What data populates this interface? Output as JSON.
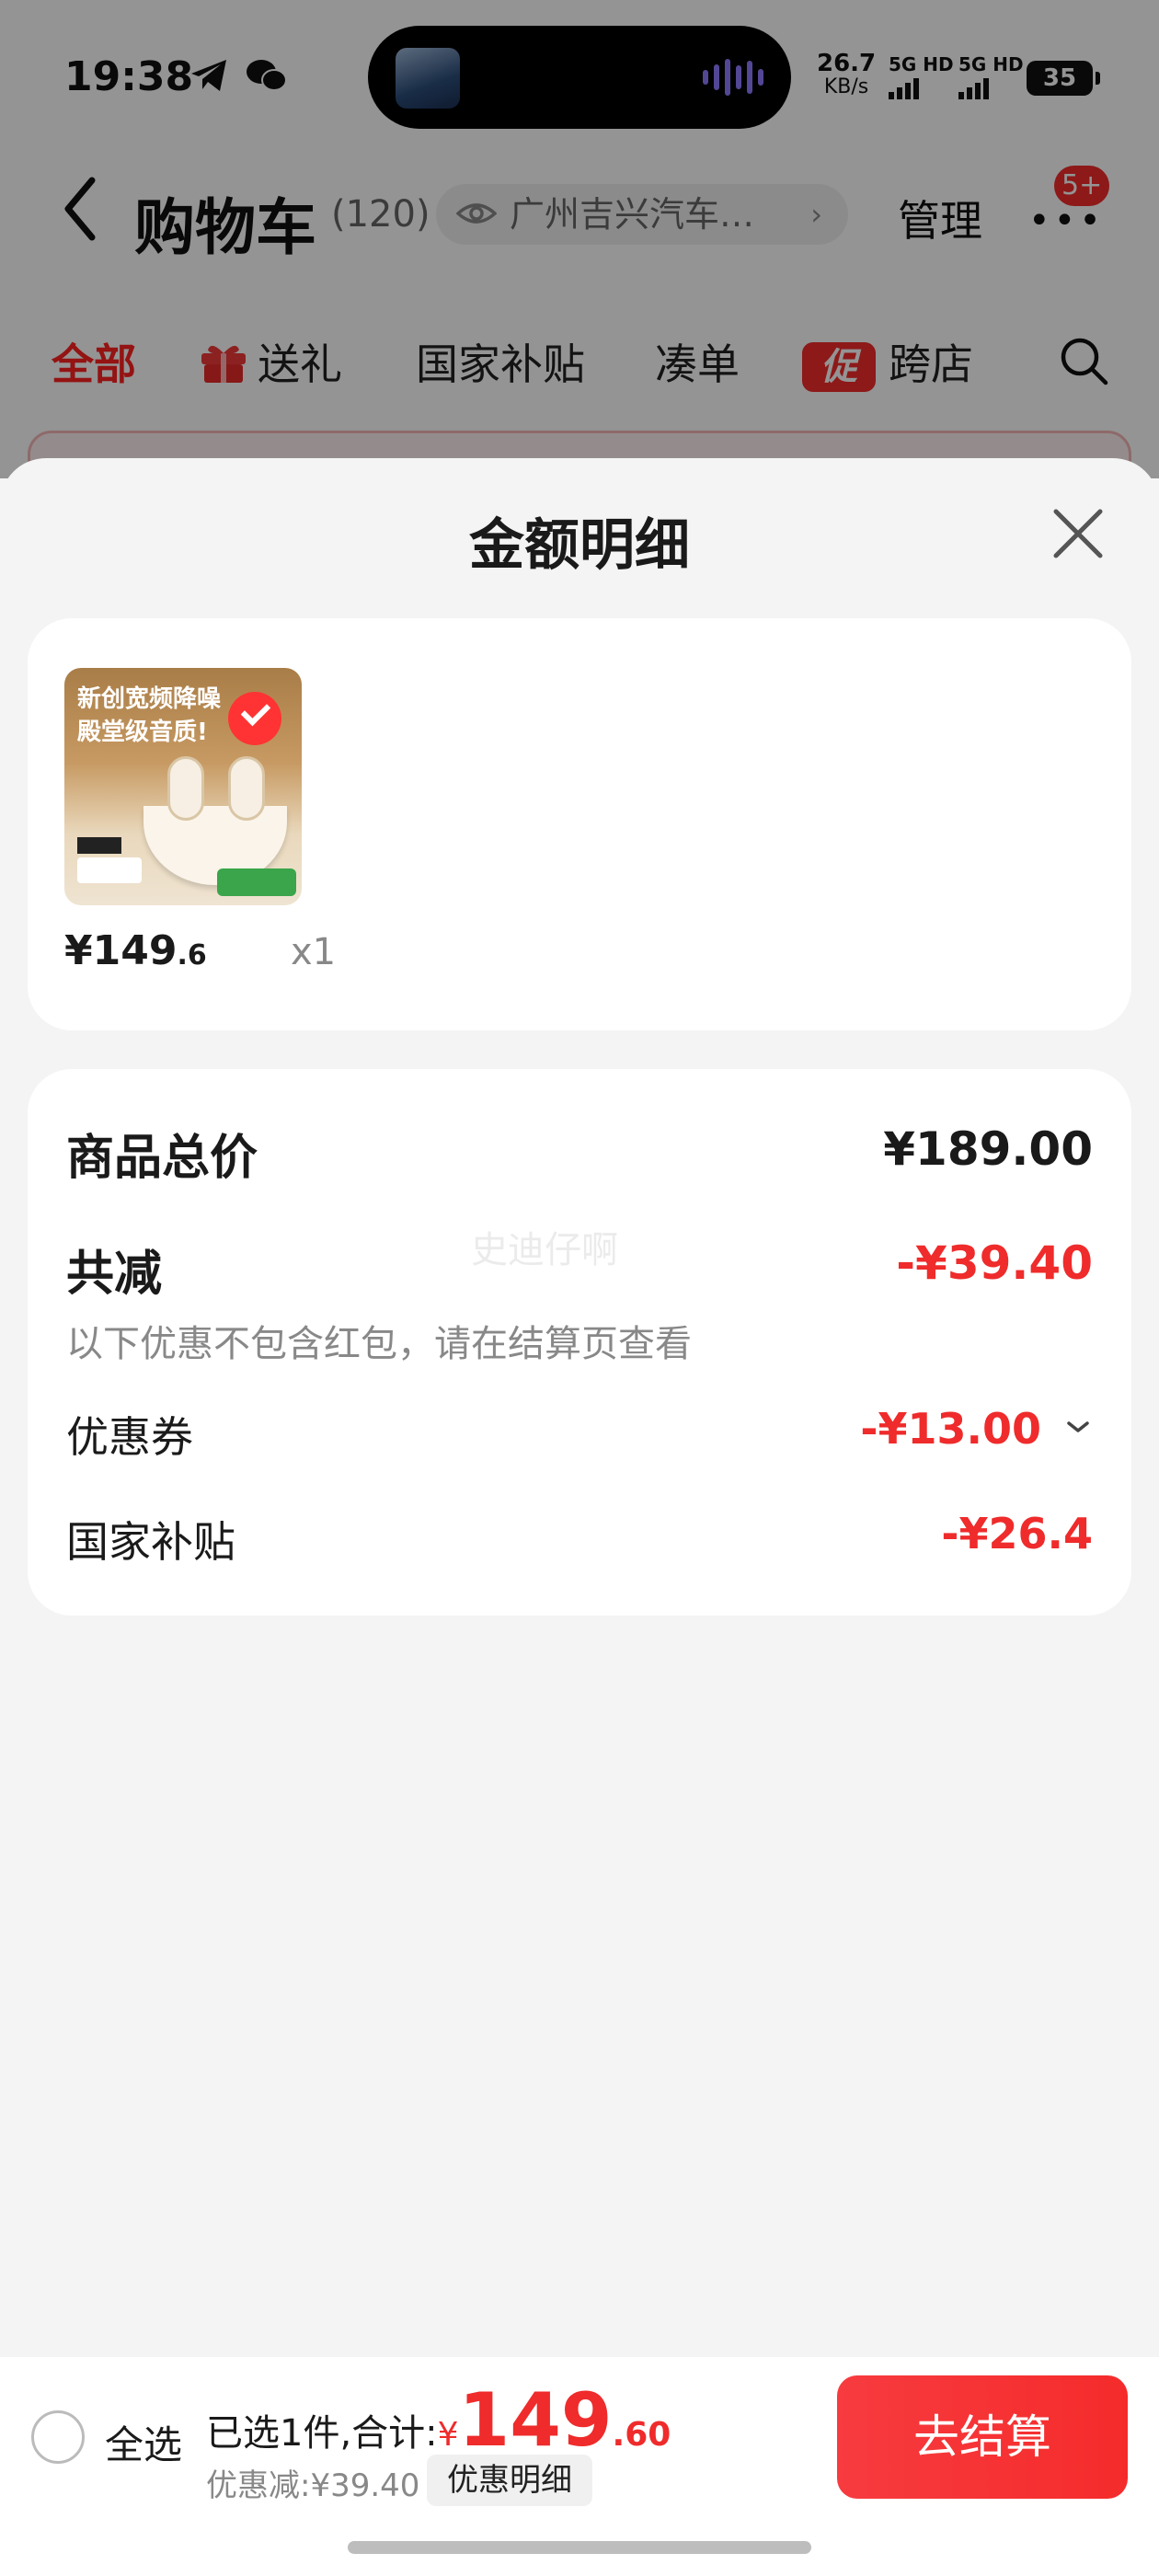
{
  "status_bar": {
    "time": "19:38",
    "net_speed": "26.7",
    "net_unit": "KB/s",
    "sim1": "5G HD",
    "sim2": "5G HD",
    "battery": "35"
  },
  "nav": {
    "title": "购物车",
    "count": "(120)",
    "address": "广州吉兴汽车…",
    "manage_label": "管理",
    "more_badge": "5+"
  },
  "tabs": [
    {
      "label": "全部",
      "active": true
    },
    {
      "label": "送礼",
      "icon": "gift-icon"
    },
    {
      "label": "国家补贴"
    },
    {
      "label": "凑单"
    },
    {
      "label": "跨店",
      "icon_text": "促"
    }
  ],
  "sheet": {
    "title": "金额明细",
    "item": {
      "image_headline": [
        "新创宽频降噪",
        "殿堂级音质!"
      ],
      "price_main": "¥149",
      "price_decimal": ".6",
      "quantity": "x1"
    },
    "summary": {
      "total_label": "商品总价",
      "total_value": "¥189.00",
      "reduce_label": "共减",
      "reduce_value": "-¥39.40",
      "note": "以下优惠不包含红包，请在结算页查看",
      "coupon_label": "优惠券",
      "coupon_value": "-¥13.00",
      "subsidy_label": "国家补贴",
      "subsidy_value": "-¥26.4",
      "watermark": "史迪仔啊"
    }
  },
  "bottom_bar": {
    "select_all": "全选",
    "selected_text": "已选1件,合计:",
    "currency": "¥",
    "total_int": "149",
    "total_dec": ".60",
    "discount_text": "优惠减:¥39.40",
    "detail_button": "优惠明细",
    "checkout_button": "去结算"
  },
  "colors": {
    "accent_red": "#ef2b2b",
    "overlay": "rgba(0,0,0,0.42)"
  }
}
